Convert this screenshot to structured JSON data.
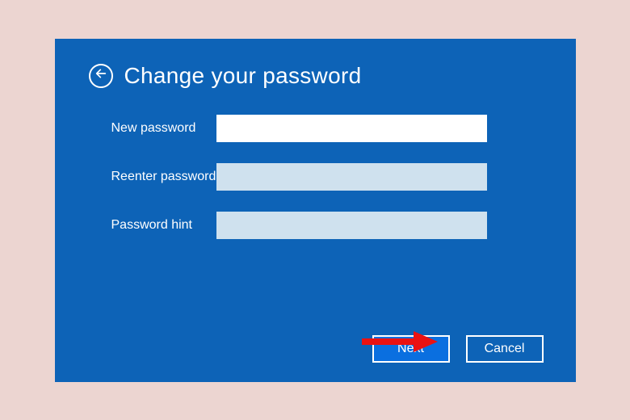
{
  "header": {
    "title": "Change your password",
    "back_icon": "back-arrow-icon"
  },
  "form": {
    "new_password": {
      "label": "New password",
      "value": "",
      "placeholder": ""
    },
    "reenter_password": {
      "label": "Reenter password",
      "value": "",
      "placeholder": ""
    },
    "password_hint": {
      "label": "Password hint",
      "value": "",
      "placeholder": ""
    }
  },
  "buttons": {
    "next_label": "Next",
    "cancel_label": "Cancel"
  },
  "colors": {
    "panel_bg": "#0d63b7",
    "page_bg": "#ecd5d1",
    "input_active_bg": "#ffffff",
    "input_inactive_bg": "#cfe1ee",
    "primary_btn_bg": "#0a6fe0",
    "annotation_arrow": "#ea1212"
  }
}
